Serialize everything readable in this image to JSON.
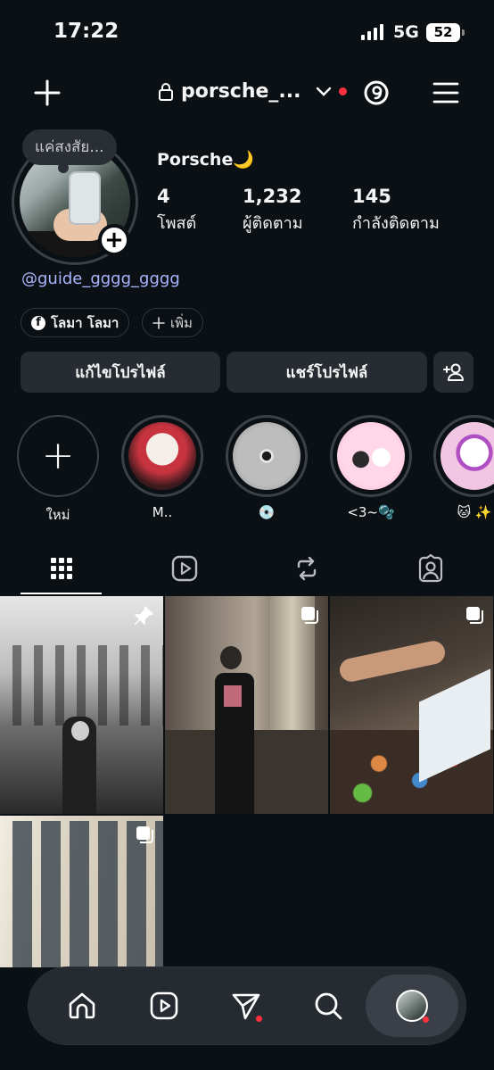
{
  "status_bar": {
    "time": "17:22",
    "network": "5G",
    "battery": "52"
  },
  "top_nav": {
    "username": "porsche_..."
  },
  "profile": {
    "note": "แค่สงสัย...",
    "display_name": "Porsche🌙",
    "stats": {
      "posts": {
        "value": "4",
        "label": "โพสต์"
      },
      "followers": {
        "value": "1,232",
        "label": "ผู้ติดตาม"
      },
      "following": {
        "value": "145",
        "label": "กำลังติดตาม"
      }
    },
    "threads_handle": "@guide_gggg_gggg",
    "chips": {
      "facebook": "โลมา โลมา",
      "add": "เพิ่ม"
    }
  },
  "actions": {
    "edit_profile": "แก้ไขโปรไฟล์",
    "share_profile": "แชร์โปรไฟล์"
  },
  "highlights": [
    {
      "caption": "ใหม่"
    },
    {
      "caption": "M.."
    },
    {
      "caption": "💿"
    },
    {
      "caption": "<3~🫧"
    },
    {
      "caption": "🐱 ✨"
    }
  ],
  "colors": {
    "background": "#0b1014",
    "surface": "#272c33",
    "link": "#a9b6ff",
    "notification": "#ff3040"
  },
  "icons": {
    "top_nav": [
      "plus-icon",
      "lock-icon",
      "chevron-down-icon",
      "threads-icon",
      "menu-icon"
    ],
    "tabs": [
      "grid-icon",
      "reels-icon",
      "reposts-icon",
      "tagged-icon"
    ],
    "bottom_nav": [
      "home-icon",
      "reels-icon",
      "send-icon",
      "search-icon",
      "profile-avatar"
    ]
  }
}
